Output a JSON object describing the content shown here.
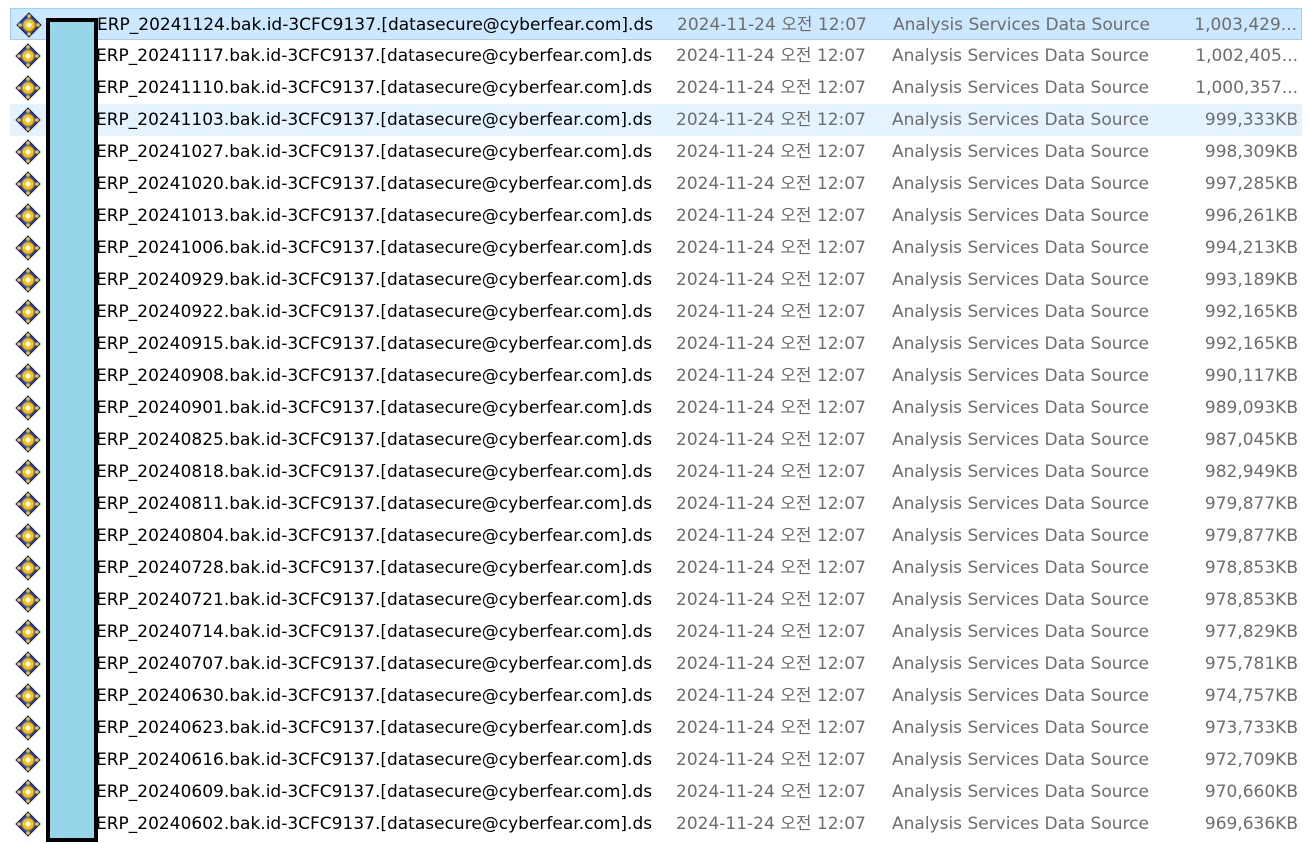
{
  "files": [
    {
      "name": "ERP_20241124.bak.id-3CFC9137.[datasecure@cyberfear.com].ds",
      "date": "2024-11-24 오전 12:07",
      "type": "Analysis Services Data Source",
      "size": "1,003,429...",
      "icon": "analysis-data-source-icon",
      "state": "selected"
    },
    {
      "name": "ERP_20241117.bak.id-3CFC9137.[datasecure@cyberfear.com].ds",
      "date": "2024-11-24 오전 12:07",
      "type": "Analysis Services Data Source",
      "size": "1,002,405...",
      "icon": "analysis-data-source-icon",
      "state": ""
    },
    {
      "name": "ERP_20241110.bak.id-3CFC9137.[datasecure@cyberfear.com].ds",
      "date": "2024-11-24 오전 12:07",
      "type": "Analysis Services Data Source",
      "size": "1,000,357...",
      "icon": "analysis-data-source-icon",
      "state": ""
    },
    {
      "name": "ERP_20241103.bak.id-3CFC9137.[datasecure@cyberfear.com].ds",
      "date": "2024-11-24 오전 12:07",
      "type": "Analysis Services Data Source",
      "size": "999,333KB",
      "icon": "analysis-data-source-icon",
      "state": "hover"
    },
    {
      "name": "ERP_20241027.bak.id-3CFC9137.[datasecure@cyberfear.com].ds",
      "date": "2024-11-24 오전 12:07",
      "type": "Analysis Services Data Source",
      "size": "998,309KB",
      "icon": "analysis-data-source-icon",
      "state": ""
    },
    {
      "name": "ERP_20241020.bak.id-3CFC9137.[datasecure@cyberfear.com].ds",
      "date": "2024-11-24 오전 12:07",
      "type": "Analysis Services Data Source",
      "size": "997,285KB",
      "icon": "analysis-data-source-icon",
      "state": ""
    },
    {
      "name": "ERP_20241013.bak.id-3CFC9137.[datasecure@cyberfear.com].ds",
      "date": "2024-11-24 오전 12:07",
      "type": "Analysis Services Data Source",
      "size": "996,261KB",
      "icon": "analysis-data-source-icon",
      "state": ""
    },
    {
      "name": "ERP_20241006.bak.id-3CFC9137.[datasecure@cyberfear.com].ds",
      "date": "2024-11-24 오전 12:07",
      "type": "Analysis Services Data Source",
      "size": "994,213KB",
      "icon": "analysis-data-source-icon",
      "state": ""
    },
    {
      "name": "ERP_20240929.bak.id-3CFC9137.[datasecure@cyberfear.com].ds",
      "date": "2024-11-24 오전 12:07",
      "type": "Analysis Services Data Source",
      "size": "993,189KB",
      "icon": "analysis-data-source-icon",
      "state": ""
    },
    {
      "name": "ERP_20240922.bak.id-3CFC9137.[datasecure@cyberfear.com].ds",
      "date": "2024-11-24 오전 12:07",
      "type": "Analysis Services Data Source",
      "size": "992,165KB",
      "icon": "analysis-data-source-icon",
      "state": ""
    },
    {
      "name": "ERP_20240915.bak.id-3CFC9137.[datasecure@cyberfear.com].ds",
      "date": "2024-11-24 오전 12:07",
      "type": "Analysis Services Data Source",
      "size": "992,165KB",
      "icon": "analysis-data-source-icon",
      "state": ""
    },
    {
      "name": "ERP_20240908.bak.id-3CFC9137.[datasecure@cyberfear.com].ds",
      "date": "2024-11-24 오전 12:07",
      "type": "Analysis Services Data Source",
      "size": "990,117KB",
      "icon": "analysis-data-source-icon",
      "state": ""
    },
    {
      "name": "ERP_20240901.bak.id-3CFC9137.[datasecure@cyberfear.com].ds",
      "date": "2024-11-24 오전 12:07",
      "type": "Analysis Services Data Source",
      "size": "989,093KB",
      "icon": "analysis-data-source-icon",
      "state": ""
    },
    {
      "name": "ERP_20240825.bak.id-3CFC9137.[datasecure@cyberfear.com].ds",
      "date": "2024-11-24 오전 12:07",
      "type": "Analysis Services Data Source",
      "size": "987,045KB",
      "icon": "analysis-data-source-icon",
      "state": ""
    },
    {
      "name": "ERP_20240818.bak.id-3CFC9137.[datasecure@cyberfear.com].ds",
      "date": "2024-11-24 오전 12:07",
      "type": "Analysis Services Data Source",
      "size": "982,949KB",
      "icon": "analysis-data-source-icon",
      "state": ""
    },
    {
      "name": "ERP_20240811.bak.id-3CFC9137.[datasecure@cyberfear.com].ds",
      "date": "2024-11-24 오전 12:07",
      "type": "Analysis Services Data Source",
      "size": "979,877KB",
      "icon": "analysis-data-source-icon",
      "state": ""
    },
    {
      "name": "ERP_20240804.bak.id-3CFC9137.[datasecure@cyberfear.com].ds",
      "date": "2024-11-24 오전 12:07",
      "type": "Analysis Services Data Source",
      "size": "979,877KB",
      "icon": "analysis-data-source-icon",
      "state": ""
    },
    {
      "name": "ERP_20240728.bak.id-3CFC9137.[datasecure@cyberfear.com].ds",
      "date": "2024-11-24 오전 12:07",
      "type": "Analysis Services Data Source",
      "size": "978,853KB",
      "icon": "analysis-data-source-icon",
      "state": ""
    },
    {
      "name": "ERP_20240721.bak.id-3CFC9137.[datasecure@cyberfear.com].ds",
      "date": "2024-11-24 오전 12:07",
      "type": "Analysis Services Data Source",
      "size": "978,853KB",
      "icon": "analysis-data-source-icon",
      "state": ""
    },
    {
      "name": "ERP_20240714.bak.id-3CFC9137.[datasecure@cyberfear.com].ds",
      "date": "2024-11-24 오전 12:07",
      "type": "Analysis Services Data Source",
      "size": "977,829KB",
      "icon": "analysis-data-source-icon",
      "state": ""
    },
    {
      "name": "ERP_20240707.bak.id-3CFC9137.[datasecure@cyberfear.com].ds",
      "date": "2024-11-24 오전 12:07",
      "type": "Analysis Services Data Source",
      "size": "975,781KB",
      "icon": "analysis-data-source-icon",
      "state": ""
    },
    {
      "name": "ERP_20240630.bak.id-3CFC9137.[datasecure@cyberfear.com].ds",
      "date": "2024-11-24 오전 12:07",
      "type": "Analysis Services Data Source",
      "size": "974,757KB",
      "icon": "analysis-data-source-icon",
      "state": ""
    },
    {
      "name": "ERP_20240623.bak.id-3CFC9137.[datasecure@cyberfear.com].ds",
      "date": "2024-11-24 오전 12:07",
      "type": "Analysis Services Data Source",
      "size": "973,733KB",
      "icon": "analysis-data-source-icon",
      "state": ""
    },
    {
      "name": "ERP_20240616.bak.id-3CFC9137.[datasecure@cyberfear.com].ds",
      "date": "2024-11-24 오전 12:07",
      "type": "Analysis Services Data Source",
      "size": "972,709KB",
      "icon": "analysis-data-source-icon",
      "state": ""
    },
    {
      "name": "ERP_20240609.bak.id-3CFC9137.[datasecure@cyberfear.com].ds",
      "date": "2024-11-24 오전 12:07",
      "type": "Analysis Services Data Source",
      "size": "970,660KB",
      "icon": "analysis-data-source-icon",
      "state": ""
    },
    {
      "name": "ERP_20240602.bak.id-3CFC9137.[datasecure@cyberfear.com].ds",
      "date": "2024-11-24 오전 12:07",
      "type": "Analysis Services Data Source",
      "size": "969,636KB",
      "icon": "analysis-data-source-icon",
      "state": ""
    }
  ],
  "colors": {
    "selected_bg": "#cce8ff",
    "selected_border": "#99d1ff",
    "hover_bg": "#e5f3ff",
    "secondary_text": "#6d6d6d",
    "redaction_fill": "#97d6e8",
    "redaction_border": "#000000"
  }
}
